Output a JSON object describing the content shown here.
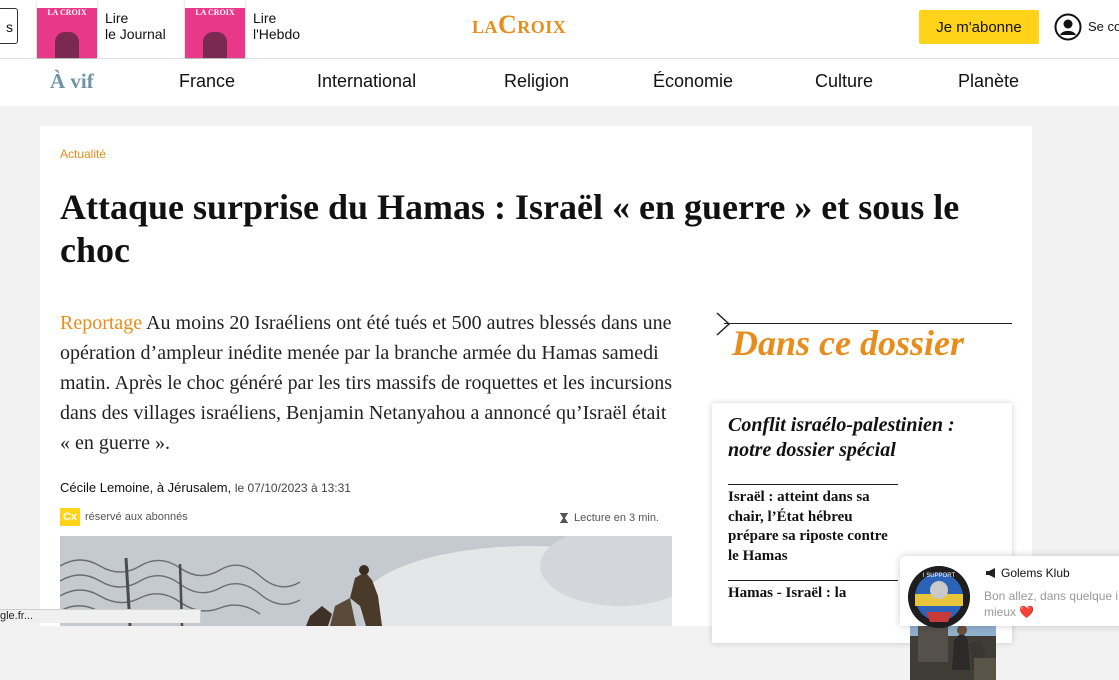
{
  "header": {
    "left_cut_label": "s",
    "promo_journal": {
      "line1": "Lire",
      "line2": "le Journal",
      "cover_mast": "LA CROIX",
      "cover_tag": ""
    },
    "promo_hebdo": {
      "line1": "Lire",
      "line2": "l'Hebdo",
      "cover_mast": "LA CROIX",
      "cover_tag": ""
    },
    "logo": {
      "part1": "LA",
      "part2": "C",
      "part3": "ROIX"
    },
    "subscribe_label": "Je m'abonne",
    "account_label": "Se co"
  },
  "nav": {
    "items": [
      "À vif",
      "France",
      "International",
      "Religion",
      "Économie",
      "Culture",
      "Planète"
    ]
  },
  "article": {
    "kicker": "Actualité",
    "headline": "Attaque surprise du Hamas : Israël « en guerre » et sous le choc",
    "lede_label": "Reportage",
    "lede_text": "Au moins 20 Israéliens ont été tués et 500 autres blessés dans une opération d’ampleur inédite menée par la branche armée du Hamas samedi matin. Après le choc généré par les tirs massifs de roquettes et les incursions dans des villages israéliens, Benjamin Netanyahou a annoncé qu’Israël était « en guerre ».",
    "author": "Cécile Lemoine, à Jérusalem,",
    "date": "le 07/10/2023 à 13:31",
    "subscriber_badge": "Cx",
    "subscriber_text": "réservé aux abonnés",
    "read_time": "Lecture en 3 min."
  },
  "dossier": {
    "title": "Dans ce dossier",
    "box_title": "Conflit israélo-palestinien : notre dossier spécial",
    "items": [
      "Israël : atteint dans sa chair, l’État hébreu prépare sa riposte contre le Hamas",
      "Hamas - Israël : la"
    ]
  },
  "chat": {
    "name": "Golems Klub",
    "message": "Bon allez, dans quelque ira mieux",
    "heart": "❤️",
    "avatar_text": "I SUPPORT"
  },
  "status_bar": {
    "text": "gle.fr..."
  },
  "colors": {
    "accent_orange": "#e88c1c",
    "subscribe_yellow": "#ffd31a",
    "vif_blue": "#6f93a8"
  }
}
